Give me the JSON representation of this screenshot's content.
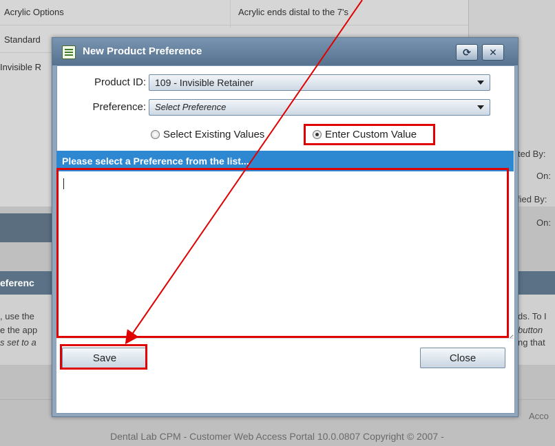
{
  "background": {
    "rows": [
      {
        "left": "Acrylic Options",
        "right": "Acrylic ends distal to the 7's"
      },
      {
        "left": "Standard",
        "right": ""
      },
      {
        "left": "Invisible R",
        "right": ""
      }
    ],
    "right_labels": [
      "ted By:",
      "On:",
      "fied By:",
      "On:"
    ],
    "preferences_header": "eferenc",
    "left_fragments": [
      ", use the",
      "e the app",
      "s set to a"
    ],
    "right_fragments": [
      "ds. To I",
      "button",
      "ng that"
    ],
    "footer_right_fragment": "Acco",
    "footer_text": "Dental Lab CPM - Customer Web Access Portal 10.0.0807    Copyright © 2007 - "
  },
  "dialog": {
    "title": "New Product Preference",
    "refresh_glyph": "⟳",
    "close_glyph": "✕",
    "product_label": "Product ID:",
    "product_value": "109 - Invisible Retainer",
    "preference_label": "Preference:",
    "preference_placeholder": "Select Preference",
    "radio_existing": "Select Existing Values",
    "radio_custom": "Enter Custom Value",
    "info_bar": "Please select a Preference from the list...",
    "custom_value": "",
    "save_label": "Save",
    "close_label": "Close"
  },
  "colors": {
    "highlight": "#e00000",
    "info_bar": "#2e87d1",
    "title_bar": "#56728f"
  }
}
